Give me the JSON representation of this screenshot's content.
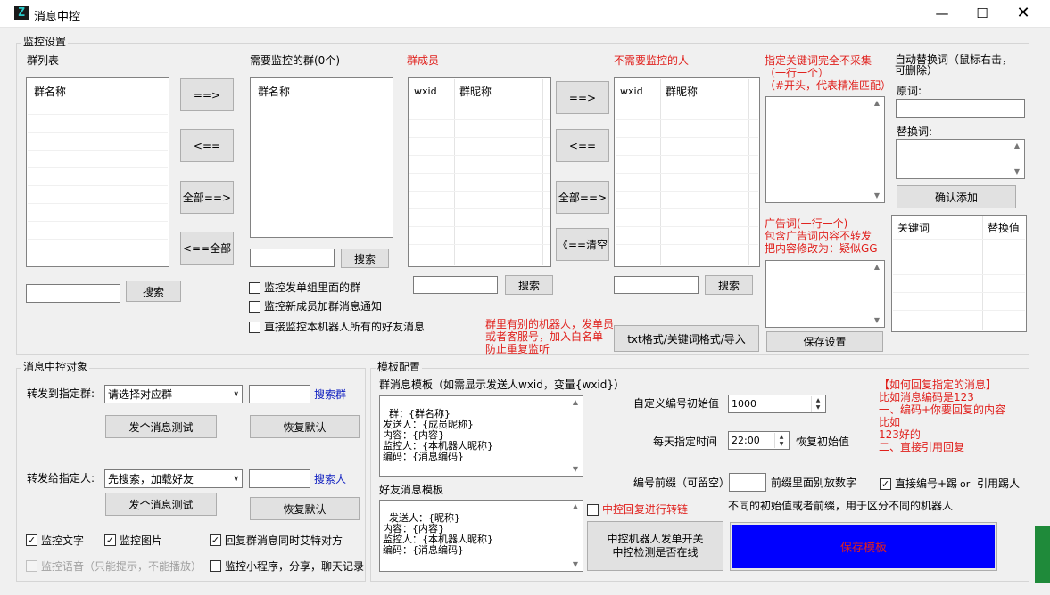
{
  "window": {
    "title": "消息中控",
    "icon": "Z",
    "min_icon": "minimize-icon",
    "max_icon": "maximize-icon",
    "close_icon": "close-icon"
  },
  "monitor": {
    "group_label": "监控设置",
    "group_list": {
      "label": "群列表",
      "header": "群名称",
      "search": "搜索"
    },
    "arrows1": {
      "add": "==>",
      "remove": "<==",
      "add_all": "全部==>",
      "remove_all": "<==全部"
    },
    "watched": {
      "label": "需要监控的群(0个)",
      "header": "群名称",
      "search": "搜索"
    },
    "members": {
      "label": "群成员",
      "col1": "wxid",
      "col2": "群昵称",
      "search": "搜索"
    },
    "arrows2": {
      "add": "==>",
      "remove": "<==",
      "add_all": "全部==>",
      "clear": "《==清空"
    },
    "excluded": {
      "label": "不需要监控的人",
      "col1": "wxid",
      "col2": "群昵称",
      "search": "搜索"
    },
    "checks": [
      {
        "label": "监控发单组里面的群",
        "checked": false
      },
      {
        "label": "监控新成员加群消息通知",
        "checked": false
      },
      {
        "label": "直接监控本机器人所有的好友消息",
        "checked": false
      }
    ],
    "whitelist_note": "群里有别的机器人，发单员\n或者客服号，加入白名单\n防止重复监听",
    "import_button": "txt格式/关键词格式/导入",
    "keyword_label": "指定关键词完全不采集\n（一行一个）\n（#开头，代表精准匹配）",
    "ad_label": "广告词(一行一个)\n包含广告词内容不转发\n把内容修改为：疑似GG",
    "save_settings": "保存设置",
    "replace": {
      "label": "自动替换词（鼠标右击，\n可删除）",
      "orig_label": "原词:",
      "repl_label": "替换词:",
      "confirm": "确认添加",
      "col1": "关键词",
      "col2": "替换值"
    }
  },
  "target": {
    "group_label": "消息中控对象",
    "forward_group_label": "转发到指定群:",
    "forward_group_select": "请选择对应群",
    "search_group": "搜索群",
    "test1": "发个消息测试",
    "reset1": "恢复默认",
    "forward_person_label": "转发给指定人:",
    "forward_person_select": "先搜索，加载好友",
    "search_person": "搜索人",
    "test2": "发个消息测试",
    "reset2": "恢复默认",
    "checks": [
      {
        "label": "监控文字",
        "checked": true
      },
      {
        "label": "监控图片",
        "checked": true
      },
      {
        "label": "回复群消息同时艾特对方",
        "checked": true
      },
      {
        "label": "监控语音（只能提示，不能播放）",
        "checked": false,
        "disabled": true
      },
      {
        "label": "监控小程序，分享，聊天记录",
        "checked": false
      }
    ]
  },
  "template": {
    "group_label": "模板配置",
    "group_tpl_label": "群消息模板（如需显示发送人wxid，变量{wxid}）",
    "group_tpl": "群：{群名称}\n发送人：{成员昵称}\n内容：{内容}\n监控人：{本机器人昵称}\n编码：{消息编码}",
    "friend_tpl_label": "好友消息模板",
    "friend_tpl": "发送人：{昵称}\n内容：{内容}\n监控人：{本机器人昵称}\n编码：{消息编码}",
    "start_num_label": "自定义编号初始值",
    "start_num": "1000",
    "daily_time_label": "每天指定时间",
    "daily_time": "22:00",
    "reset_start": "恢复初始值",
    "prefix_label": "编号前缀（可留空）",
    "prefix": "",
    "prefix_note": "前缀里面别放数字",
    "direct_reply_label": "直接编号+踢",
    "or_text": "or",
    "quote_reply": "引用踢人",
    "reply_chain_label": "中控回复进行转链",
    "reply_chain_checked": false,
    "distinct_note": "不同的初始值或者前缀，用于区分不同的机器人",
    "switch_button": "中控机器人发单开关\n中控检测是否在线",
    "save_template": "保存模板",
    "save_color": "#0000ff",
    "save_text_color": "#e0201c",
    "help": "【如何回复指定的消息】\n比如消息编码是123\n一、编码+你要回复的内容\n比如\n123好的\n二、直接引用回复"
  }
}
